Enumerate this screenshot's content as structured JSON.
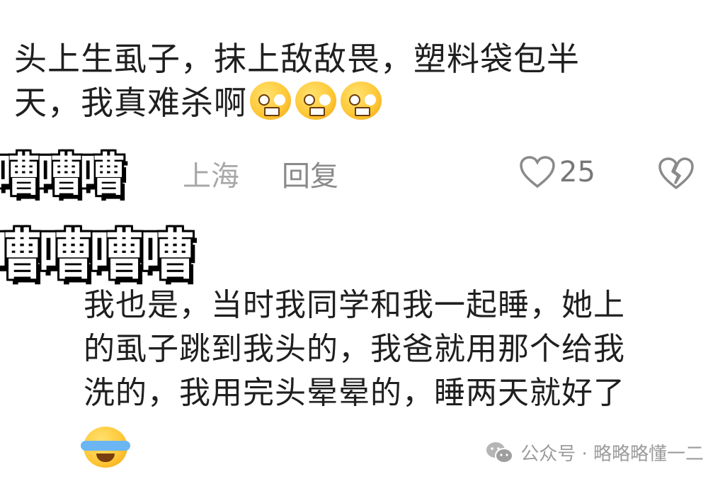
{
  "comment1": {
    "text_line1": "头上生虱子，抹上敌敌畏，塑料袋包半",
    "text_line2": "天，我真难杀啊",
    "emojis": [
      "crying-grimace-emoji",
      "crying-grimace-emoji",
      "crying-grimace-emoji"
    ],
    "location": "上海",
    "reply_label": "回复",
    "like_count": "25"
  },
  "sticker_overlay": {
    "line1": "嘈嘈嘈",
    "line2": "嘈嘈嘈嘈"
  },
  "reply": {
    "text_line1": "我也是，当时我同学和我一起睡，她上",
    "text_line2": "的虱子跳到我头的，我爸就用那个给我",
    "text_line3": "洗的，我用完头晕晕的，睡两天就好了",
    "emoji": "tears-of-joy-emoji"
  },
  "watermark": {
    "text": "公众号 · 略略略懂一二"
  },
  "colors": {
    "text": "#1f1f1f",
    "meta": "#a8a8a8",
    "emoji": "#ffc93a"
  }
}
